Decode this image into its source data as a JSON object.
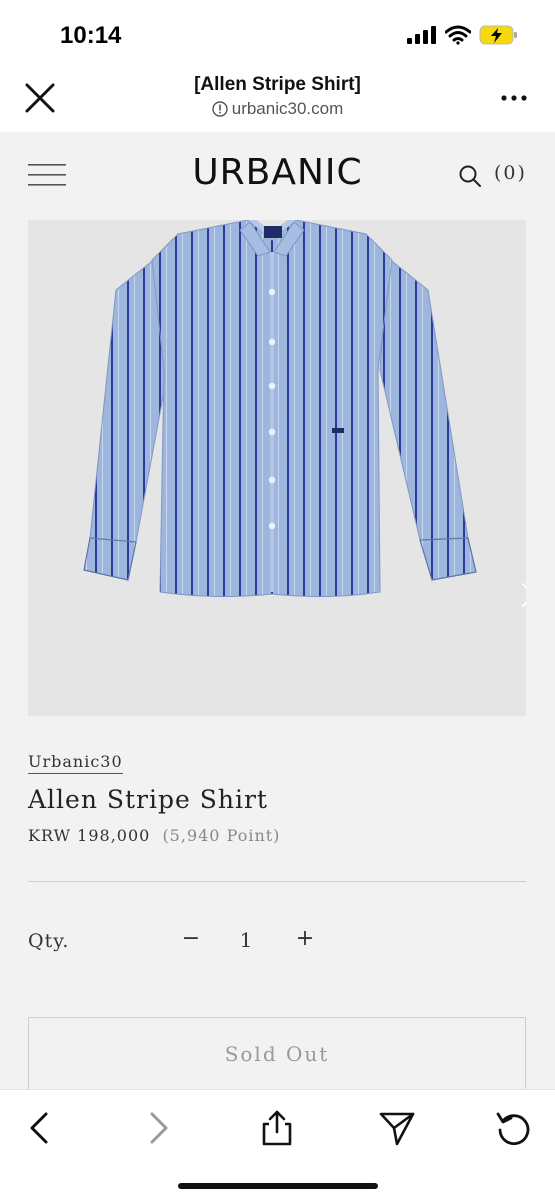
{
  "status": {
    "time": "10:14"
  },
  "browser": {
    "title": "[Allen Stripe Shirt]",
    "url": "urbanic30.com"
  },
  "site": {
    "logo": "URBANIC",
    "cart_count": "(0)"
  },
  "product": {
    "brand": "Urbanic30",
    "name": "Allen Stripe Shirt",
    "price": "KRW 198,000",
    "points": "(5,940 Point)",
    "qty_label": "Qty.",
    "qty_minus": "−",
    "qty_value": "1",
    "qty_plus": "+",
    "soldout_label": "Sold Out"
  },
  "icons": {
    "close": "close-icon",
    "more": "more-icon",
    "menu": "hamburger-icon",
    "search": "search-icon",
    "back": "chevron-left-icon",
    "forward": "chevron-right-icon",
    "share": "share-icon",
    "send": "send-icon",
    "reload": "reload-icon"
  },
  "colors": {
    "battery": "#f5d90a",
    "stripe_light": "#9db6de",
    "stripe_dark": "#2a3c92"
  }
}
